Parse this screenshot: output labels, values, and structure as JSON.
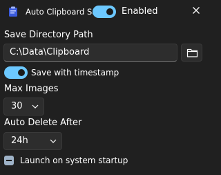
{
  "header": {
    "app_title": "Auto Clipboard Saver",
    "enabled_label": "Enabled",
    "enabled": true,
    "icon": "app-icon",
    "close_icon": "close-icon"
  },
  "save_path": {
    "label": "Save Directory Path",
    "value": "C:\\Data\\Clipboard",
    "browse_icon": "folder-icon"
  },
  "timestamp": {
    "label": "Save with timestamp",
    "enabled": true
  },
  "max_images": {
    "label": "Max Images",
    "value": "30"
  },
  "auto_delete": {
    "label": "Auto Delete After",
    "value": "24h"
  },
  "startup": {
    "label": "Launch on system startup",
    "state": "indeterminate"
  },
  "colors": {
    "background": "#202020",
    "accent": "#6cc8ff",
    "control_bg": "#2d2d2d",
    "checkbox": "#9fb3c8"
  }
}
